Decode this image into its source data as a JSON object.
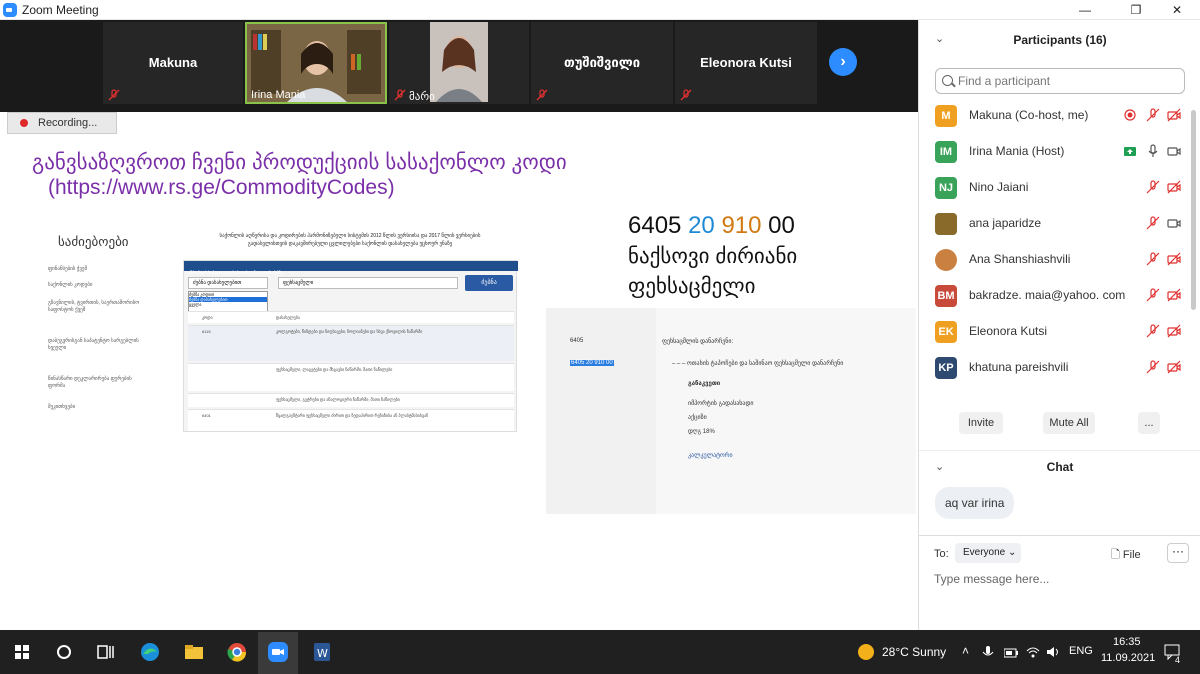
{
  "window": {
    "title": "Zoom Meeting",
    "controls": [
      "—",
      "❐",
      "✕"
    ]
  },
  "video_strip": {
    "tiles": [
      {
        "name": "Makuna",
        "label": ""
      },
      {
        "name": "",
        "label": "Irina Mania"
      },
      {
        "name": "",
        "label": "მარი"
      },
      {
        "name": "თუშიშვილი",
        "label": ""
      },
      {
        "name": "Eleonora Kutsi",
        "label": ""
      }
    ],
    "next_label": "›"
  },
  "recording": {
    "label": "Recording..."
  },
  "slide": {
    "title": "განვსაზღვროთ ჩვენი პროდუქციის სასაქონლო კოდი",
    "url": "(https://www.rs.ge/CommodityCodes)",
    "code_parts": [
      "64",
      "05",
      "20",
      "910",
      "00"
    ],
    "product_name": "ნაქსოვი ძირიანი ფეხსაცმელი",
    "web": {
      "heading": "საძიებოები",
      "header_text": "საქონლის აღწერისა და კოდირების ჰარმონიზებული სისტემის 2012 წლის ვერსიისა და 2017 წლის ვერსიების გადასვლისთვის დაკავშირებული ცვლილებები საქონლის დასახელება უცხოურ ენაზე",
      "left_nav": [
        "ფინანსების ქვეშ",
        "საქონლის კოდები",
        "გზავნილის, ტვირთის, საერთაშორისო საფოსტოს ქვეშ",
        "დაბეგვრისგან საპატენტო სარგებლის ხვეული",
        "წინასწარი დეკლარირება ფურების ფორმა",
        "შეკითხვები"
      ],
      "bar_text": "იმპორტის საბაჟო გადასახადის განაკვეთის ძებნა",
      "select_value": "ძებნა დასახელებით",
      "input_value": "ფეხსაცმელი",
      "search_button": "ძებნა",
      "dropdown_options": [
        "ძებნა კოდით",
        "ძებნა დასახელებით",
        "ყველა"
      ],
      "rows": [
        {
          "code": "კოდი",
          "desc": "დასახელება"
        },
        {
          "code": "6115",
          "desc": "კოლგოტები, წინდები და ნიფხავები, ზოლიანები და სხვა ქსოვილის ნაწარმი"
        },
        {
          "code": "",
          "desc": "ფეხსაცმელი, ლაგეტები და მსგავსი ნაწარმი; მათი ნაწილები"
        },
        {
          "code": "",
          "desc": "ფეხსაცმელი, გეტრები და ანალოგიური ნაწარმი; მათი ნაწილები"
        },
        {
          "code": "6401",
          "desc": "წყალგაუმტარი ფეხსაცმელი ძირით და ზედაპირით რეზინისა ან პლასტმასისგან"
        }
      ]
    },
    "web2": {
      "code1": "6405",
      "col1": "ფეხსაცმლის დანარჩენი:",
      "code2": "6405 20 910 00",
      "col2": "– – – ოთახის ტაპოჩები და საშინაო ფეხსაცმელი დანარჩენი",
      "section": "განაკვეთი",
      "lines": [
        "იმპორტის გადასახადი",
        "აქციზი",
        "დღგ 18%"
      ],
      "link": "კალკულატორი"
    }
  },
  "participants": {
    "title": "Participants (16)",
    "search_placeholder": "Find a participant",
    "list": [
      {
        "initials": "M",
        "name": "Makuna (Co-host, me)",
        "color": "#f0a020"
      },
      {
        "initials": "IM",
        "name": "Irina Mania (Host)",
        "color": "#3aa35a"
      },
      {
        "initials": "NJ",
        "name": "Nino Jaiani",
        "color": "#3aa35a"
      },
      {
        "initials": "",
        "name": "ana japaridze",
        "color": "#8a6a2a"
      },
      {
        "initials": "",
        "name": "Ana Shanshiashvili",
        "color": "#c98040"
      },
      {
        "initials": "BM",
        "name": "bakradze. maia@yahoo. com",
        "color": "#c74a3a"
      },
      {
        "initials": "EK",
        "name": "Eleonora Kutsi",
        "color": "#f0a020"
      },
      {
        "initials": "KP",
        "name": "khatuna pareishvili",
        "color": "#2f4a70"
      }
    ],
    "invite": "Invite",
    "mute_all": "Mute All",
    "more": "..."
  },
  "chat": {
    "title": "Chat",
    "messages": [
      "aq var irina"
    ],
    "to_label": "To:",
    "recipient": "Everyone",
    "file_label": "File",
    "more": "···",
    "input_placeholder": "Type message here..."
  },
  "taskbar": {
    "weather": "28°C  Sunny",
    "language": "ENG",
    "time": "16:35",
    "date": "11.09.2021",
    "notifications": "4"
  },
  "colors": {
    "accent": "#2d8cff",
    "slide_title": "#7a2fa8",
    "muted_red": "#e03030"
  }
}
